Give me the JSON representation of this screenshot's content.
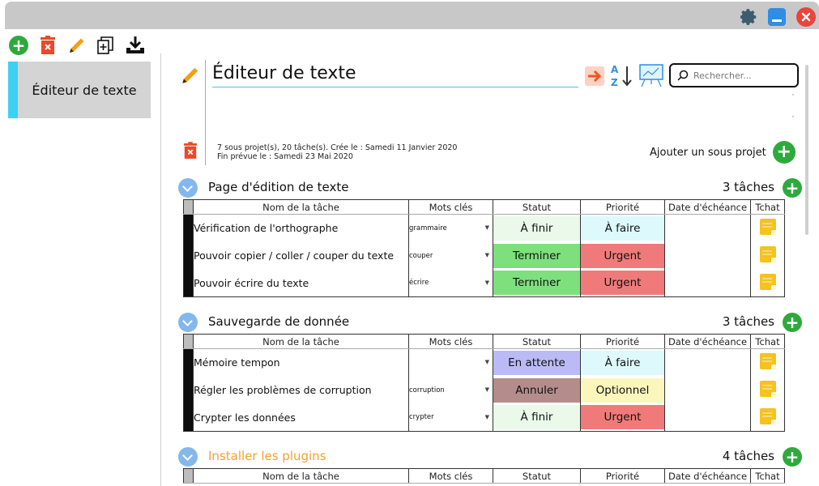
{
  "colors": {
    "accent": "#3ed0f0",
    "add_green": "#2eaa3c",
    "status": {
      "À finir": "#eaf9ea",
      "Terminer": "#7de07d",
      "En attente": "#bcbaf6",
      "Annuler": "#b58c8c"
    },
    "priority": {
      "À faire": "#ddf9fb",
      "Urgent": "#f07a7a",
      "Optionnel": "#fbf6bc"
    }
  },
  "sidebar": {
    "items": [
      {
        "label": "Éditeur de texte"
      }
    ]
  },
  "toolbar": {
    "icons": [
      "add-icon",
      "delete-icon",
      "edit-icon",
      "duplicate-icon",
      "download-icon"
    ]
  },
  "project": {
    "title": "Éditeur de texte",
    "info_line1": "7 sous projet(s), 20 tâche(s). Crée le : Samedi 11 Janvier 2020",
    "info_line2": "Fin prévue le : Samedi 23 Mai 2020",
    "add_subproject": "Ajouter un sous projet",
    "search_placeholder": "Rechercher..."
  },
  "columns": [
    "Nom de la tâche",
    "Mots clés",
    "Statut",
    "Priorité",
    "Date d'échéance",
    "Tchat"
  ],
  "sections": [
    {
      "title": "Page d'édition de texte",
      "count": "3 tâches",
      "tasks": [
        {
          "name": "Vérification de l'orthographe",
          "keyword": "grammaire",
          "status": "À finir",
          "priority": "À faire",
          "due": ""
        },
        {
          "name": "Pouvoir copier / coller / couper du texte",
          "keyword": "couper",
          "status": "Terminer",
          "priority": "Urgent",
          "due": ""
        },
        {
          "name": "Pouvoir écrire du texte",
          "keyword": "écrire",
          "status": "Terminer",
          "priority": "Urgent",
          "due": ""
        }
      ]
    },
    {
      "title": "Sauvegarde de donnée",
      "count": "3 tâches",
      "tasks": [
        {
          "name": "Mémoire tempon",
          "keyword": "",
          "status": "En attente",
          "priority": "À faire",
          "due": ""
        },
        {
          "name": "Régler les problèmes de corruption",
          "keyword": "corruption",
          "status": "Annuler",
          "priority": "Optionnel",
          "due": ""
        },
        {
          "name": "Crypter les données",
          "keyword": "crypter",
          "status": "À finir",
          "priority": "Urgent",
          "due": ""
        }
      ]
    },
    {
      "title": "Installer les plugins",
      "count": "4 tâches",
      "tasks": []
    }
  ]
}
